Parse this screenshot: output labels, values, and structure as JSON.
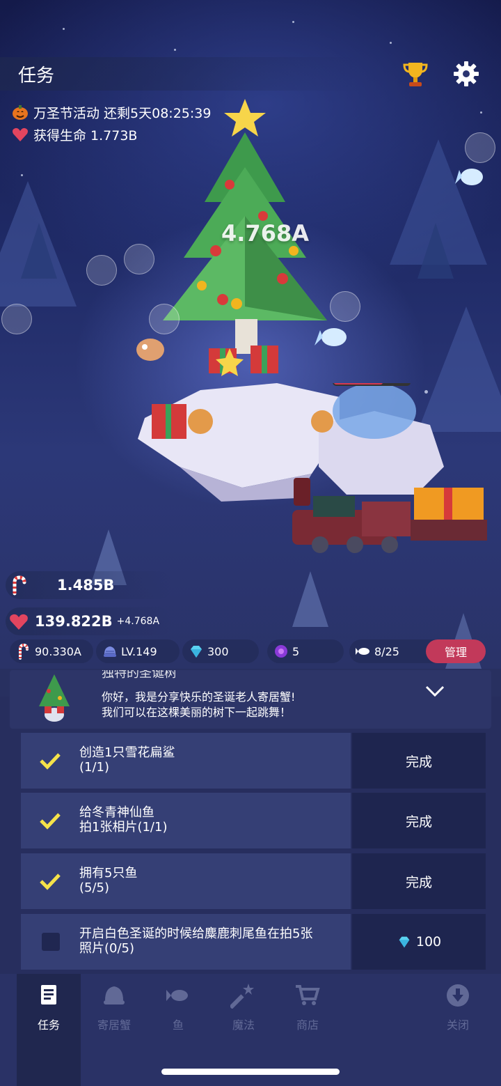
{
  "header": {
    "title": "任务"
  },
  "event": {
    "label": "万圣节活动 还剩5天08:25:39",
    "life": "获得生命 1.773B"
  },
  "scene": {
    "tree_life": "4.768A"
  },
  "resources": {
    "candy": "1.485B",
    "hearts": "139.822B",
    "hearts_rate": "+4.768A"
  },
  "stats": {
    "candy": "90.330A",
    "level": "LV.149",
    "gems": "300",
    "orbs": "5",
    "fish": "8/25",
    "manage": "管理"
  },
  "quest": {
    "name": "独特的圣诞树",
    "line1": "你好，我是分享快乐的圣诞老人寄居蟹!",
    "line2": "我们可以在这棵美丽的树下一起跳舞！"
  },
  "tasks": [
    {
      "line1": "创造1只雪花扁鲨",
      "line2": "(1/1)",
      "status": "完成",
      "done": true
    },
    {
      "line1": "给冬青神仙鱼",
      "line2": "拍1张相片(1/1)",
      "status": "完成",
      "done": true
    },
    {
      "line1": "拥有5只鱼",
      "line2": "(5/5)",
      "status": "完成",
      "done": true
    },
    {
      "line1": "开启白色圣诞的时候给麋鹿刺尾鱼在拍5张",
      "line2": "照片(0/5)",
      "reward": "100",
      "done": false
    }
  ],
  "nav": {
    "tasks": "任务",
    "crabs": "寄居蟹",
    "fish": "鱼",
    "magic": "魔法",
    "shop": "商店",
    "close": "关闭"
  },
  "colors": {
    "accent": "#c2395a",
    "check": "#f5e24a",
    "panel": "#2d3668"
  }
}
